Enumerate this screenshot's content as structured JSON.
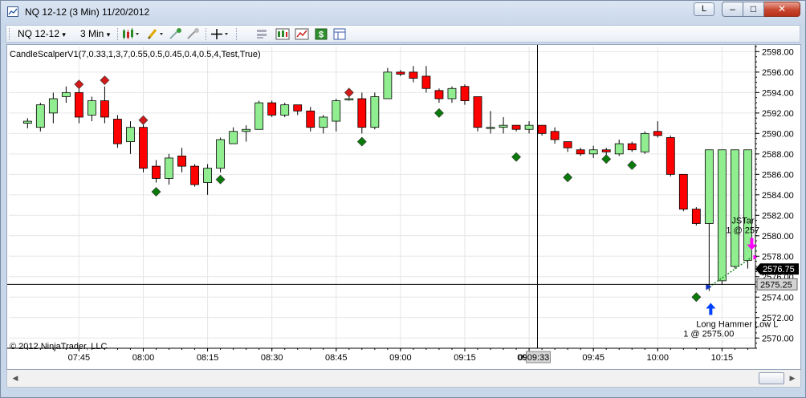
{
  "window": {
    "title": "NQ 12-12 (3 Min)  11/20/2012",
    "link_button": "L",
    "minimize_glyph": "–",
    "maximize_glyph": "□",
    "close_glyph": "✕"
  },
  "toolbar": {
    "instrument": "NQ 12-12",
    "period": "3 Min",
    "dropdown_glyph": "▾",
    "icons": [
      "bar-type-icon",
      "drawing-tool-icon",
      "hide-drawing-icon",
      "show-drawing-icon",
      "crosshair-icon",
      "zoom-icon",
      "properties-icon",
      "indicators-icon",
      "strategies-icon",
      "dollar-icon",
      "data-box-icon"
    ]
  },
  "chart": {
    "indicator_label": "CandleScalperV1(7,0.33,1,3,7,0.55,0.5,0.45,0.4,0.5,4,Test,True)",
    "copyright": "© 2012 NinjaTrader, LLC",
    "crosshair_time": "09:33",
    "crosshair_time_prefix": "09",
    "last_price_tag": "2576.75",
    "crosshair_price_tag": "2575.25",
    "signal_text_1": "Long Hammer Low L",
    "signal_text_2": "1 @ 2575.00",
    "exit_text_1": "JSTar",
    "exit_text_2": "1 @ 257",
    "colors": {
      "up_candle": "#90ee90",
      "down_candle": "#ff0000",
      "long_marker": "#0a7a0a",
      "short_marker": "#d11a1a",
      "entry_arrow": "#0040ff",
      "exit_arrow": "#ff00ff",
      "grid": "#e6e6e6",
      "price_tag_bg": "#000000",
      "crosshair_tag_bg": "#d4d4d4"
    }
  },
  "chart_data": {
    "type": "candlestick",
    "title": "NQ 12-12 (3 Min)  11/20/2012",
    "ylim": [
      2569,
      2598.5
    ],
    "y_ticks": [
      2570,
      2572,
      2574,
      2576,
      2578,
      2580,
      2582,
      2584,
      2586,
      2588,
      2590,
      2592,
      2594,
      2596,
      2598
    ],
    "y_tick_labels": [
      "2570.00",
      "2572.00",
      "2574.00",
      "2576.00",
      "2578.00",
      "2580.00",
      "2582.00",
      "2584.00",
      "2586.00",
      "2588.00",
      "2590.00",
      "2592.00",
      "2594.00",
      "2596.00",
      "2598.00"
    ],
    "x_tick_labels": [
      "07:45",
      "08:00",
      "08:15",
      "08:30",
      "08:45",
      "09:00",
      "09:15",
      "09:30",
      "09:45",
      "10:00",
      "10:15"
    ],
    "x_tick_bar_index": [
      4,
      9,
      14,
      19,
      24,
      29,
      34,
      39,
      44,
      49,
      54
    ],
    "bars": [
      {
        "o": 2591.0,
        "h": 2591.5,
        "l": 2590.5,
        "c": 2591.2
      },
      {
        "o": 2590.6,
        "h": 2593.0,
        "l": 2590.2,
        "c": 2592.8
      },
      {
        "o": 2592.0,
        "h": 2594.0,
        "l": 2591.0,
        "c": 2593.4
      },
      {
        "o": 2593.6,
        "h": 2594.6,
        "l": 2593.0,
        "c": 2594.0
      },
      {
        "o": 2594.0,
        "h": 2595.0,
        "l": 2591.0,
        "c": 2591.6
      },
      {
        "o": 2591.8,
        "h": 2593.6,
        "l": 2591.2,
        "c": 2593.2
      },
      {
        "o": 2593.2,
        "h": 2594.6,
        "l": 2591.0,
        "c": 2591.6
      },
      {
        "o": 2591.4,
        "h": 2591.8,
        "l": 2588.6,
        "c": 2589.0
      },
      {
        "o": 2589.2,
        "h": 2591.2,
        "l": 2588.0,
        "c": 2590.6
      },
      {
        "o": 2590.6,
        "h": 2591.0,
        "l": 2586.2,
        "c": 2586.6
      },
      {
        "o": 2586.8,
        "h": 2587.4,
        "l": 2585.2,
        "c": 2585.6
      },
      {
        "o": 2585.6,
        "h": 2588.0,
        "l": 2585.0,
        "c": 2587.6
      },
      {
        "o": 2587.8,
        "h": 2588.6,
        "l": 2586.2,
        "c": 2586.8
      },
      {
        "o": 2586.8,
        "h": 2587.0,
        "l": 2584.8,
        "c": 2585.0
      },
      {
        "o": 2585.2,
        "h": 2587.0,
        "l": 2584.0,
        "c": 2586.6
      },
      {
        "o": 2586.6,
        "h": 2589.6,
        "l": 2586.2,
        "c": 2589.4
      },
      {
        "o": 2589.0,
        "h": 2590.6,
        "l": 2589.0,
        "c": 2590.2
      },
      {
        "o": 2590.2,
        "h": 2590.8,
        "l": 2589.2,
        "c": 2590.4
      },
      {
        "o": 2590.4,
        "h": 2593.2,
        "l": 2590.4,
        "c": 2593.0
      },
      {
        "o": 2593.0,
        "h": 2593.2,
        "l": 2591.6,
        "c": 2591.8
      },
      {
        "o": 2591.8,
        "h": 2593.0,
        "l": 2591.6,
        "c": 2592.8
      },
      {
        "o": 2592.8,
        "h": 2592.8,
        "l": 2591.8,
        "c": 2592.2
      },
      {
        "o": 2592.2,
        "h": 2592.6,
        "l": 2590.2,
        "c": 2590.6
      },
      {
        "o": 2590.6,
        "h": 2591.8,
        "l": 2590.0,
        "c": 2591.6
      },
      {
        "o": 2591.2,
        "h": 2593.4,
        "l": 2590.2,
        "c": 2593.2
      },
      {
        "o": 2593.4,
        "h": 2593.6,
        "l": 2593.2,
        "c": 2593.4
      },
      {
        "o": 2593.4,
        "h": 2594.0,
        "l": 2590.0,
        "c": 2590.6
      },
      {
        "o": 2590.6,
        "h": 2594.0,
        "l": 2590.4,
        "c": 2593.6
      },
      {
        "o": 2593.4,
        "h": 2596.4,
        "l": 2593.4,
        "c": 2596.0
      },
      {
        "o": 2596.0,
        "h": 2596.2,
        "l": 2595.6,
        "c": 2595.8
      },
      {
        "o": 2596.0,
        "h": 2596.6,
        "l": 2595.0,
        "c": 2595.4
      },
      {
        "o": 2595.6,
        "h": 2596.6,
        "l": 2594.0,
        "c": 2594.4
      },
      {
        "o": 2594.2,
        "h": 2594.4,
        "l": 2593.0,
        "c": 2593.4
      },
      {
        "o": 2593.4,
        "h": 2594.6,
        "l": 2593.0,
        "c": 2594.4
      },
      {
        "o": 2594.6,
        "h": 2594.8,
        "l": 2592.8,
        "c": 2593.2
      },
      {
        "o": 2593.6,
        "h": 2593.6,
        "l": 2590.2,
        "c": 2590.6
      },
      {
        "o": 2590.6,
        "h": 2592.2,
        "l": 2590.0,
        "c": 2590.6
      },
      {
        "o": 2590.6,
        "h": 2591.6,
        "l": 2590.0,
        "c": 2590.8
      },
      {
        "o": 2590.8,
        "h": 2590.8,
        "l": 2590.2,
        "c": 2590.4
      },
      {
        "o": 2590.4,
        "h": 2591.2,
        "l": 2590.0,
        "c": 2590.8
      },
      {
        "o": 2590.8,
        "h": 2590.8,
        "l": 2589.8,
        "c": 2590.0
      },
      {
        "o": 2590.2,
        "h": 2590.6,
        "l": 2589.0,
        "c": 2589.4
      },
      {
        "o": 2589.2,
        "h": 2589.2,
        "l": 2588.2,
        "c": 2588.6
      },
      {
        "o": 2588.4,
        "h": 2588.6,
        "l": 2587.8,
        "c": 2588.0
      },
      {
        "o": 2588.0,
        "h": 2588.8,
        "l": 2587.6,
        "c": 2588.4
      },
      {
        "o": 2588.4,
        "h": 2588.6,
        "l": 2587.8,
        "c": 2588.2
      },
      {
        "o": 2588.0,
        "h": 2589.4,
        "l": 2587.8,
        "c": 2589.0
      },
      {
        "o": 2589.0,
        "h": 2589.2,
        "l": 2588.2,
        "c": 2588.4
      },
      {
        "o": 2588.2,
        "h": 2590.2,
        "l": 2588.0,
        "c": 2590.0
      },
      {
        "o": 2590.2,
        "h": 2591.2,
        "l": 2589.6,
        "c": 2589.8
      },
      {
        "o": 2589.6,
        "h": 2589.8,
        "l": 2585.8,
        "c": 2586.0
      },
      {
        "o": 2586.0,
        "h": 2586.0,
        "l": 2582.4,
        "c": 2582.6
      },
      {
        "o": 2582.6,
        "h": 2582.8,
        "l": 2581.0,
        "c": 2581.2
      },
      {
        "o": 2581.2,
        "h": 2588.4,
        "l": 2574.6,
        "c": 2588.4
      },
      {
        "o": 2575.6,
        "h": 2588.4,
        "l": 2575.2,
        "c": 2588.4
      },
      {
        "o": 2577.0,
        "h": 2588.4,
        "l": 2576.8,
        "c": 2588.4
      },
      {
        "o": 2577.6,
        "h": 2588.4,
        "l": 2576.8,
        "c": 2588.4
      }
    ],
    "long_markers": [
      {
        "bar": 10,
        "price": 2584.3
      },
      {
        "bar": 15,
        "price": 2585.5
      },
      {
        "bar": 26,
        "price": 2589.2
      },
      {
        "bar": 32,
        "price": 2592.0
      },
      {
        "bar": 38,
        "price": 2587.7
      },
      {
        "bar": 42,
        "price": 2585.7
      },
      {
        "bar": 45,
        "price": 2587.5
      },
      {
        "bar": 47,
        "price": 2586.9
      },
      {
        "bar": 52,
        "price": 2574.0
      }
    ],
    "short_markers": [
      {
        "bar": 4,
        "price": 2594.8
      },
      {
        "bar": 6,
        "price": 2595.2
      },
      {
        "bar": 9,
        "price": 2591.3
      },
      {
        "bar": 25,
        "price": 2594.0
      }
    ],
    "entry": {
      "bar": 53,
      "price": 2575.0,
      "label": "Long Hammer Low L",
      "detail": "1 @ 2575.00"
    },
    "exit": {
      "bar": 56,
      "price": 2577.9,
      "label": "JSTar",
      "detail": "1 @ 257"
    },
    "crosshair": {
      "time": "09:33",
      "price": 2575.25
    },
    "last_price": 2576.75
  }
}
